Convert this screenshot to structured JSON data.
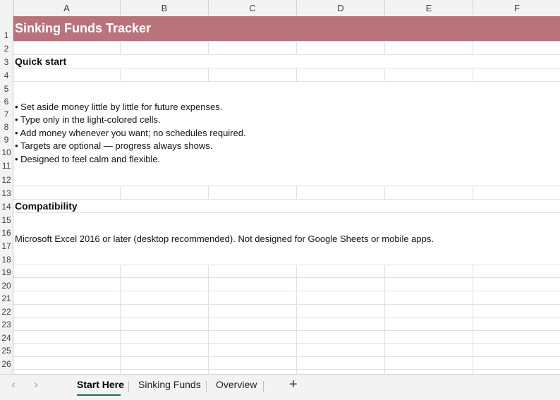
{
  "columns": [
    "A",
    "B",
    "C",
    "D",
    "E",
    "F"
  ],
  "rows": [
    "1",
    "2",
    "3",
    "4",
    "5",
    "6",
    "7",
    "8",
    "9",
    "10",
    "11",
    "12",
    "13",
    "14",
    "15",
    "16",
    "17",
    "18",
    "19",
    "20",
    "21",
    "22",
    "23",
    "24",
    "25",
    "26"
  ],
  "title": "Sinking Funds Tracker",
  "quick_start": {
    "heading": "Quick start",
    "bullets": [
      "• Set aside money little by little for future expenses.",
      "• Type only in the light-colored cells.",
      "• Add money whenever you want; no schedules required.",
      "• Targets are optional — progress always shows.",
      "• Designed to feel calm and flexible."
    ]
  },
  "compatibility": {
    "heading": "Compatibility",
    "text": "Microsoft Excel 2016 or later (desktop recommended). Not designed for Google Sheets or mobile apps."
  },
  "tabs": {
    "prev_icon": "chevron-left-icon",
    "next_icon": "chevron-right-icon",
    "items": [
      "Start Here",
      "Sinking Funds",
      "Overview"
    ],
    "active": "Start Here",
    "add_label": "+"
  },
  "colors": {
    "banner": "#b8737b",
    "active_tab_underline": "#1e7145"
  }
}
